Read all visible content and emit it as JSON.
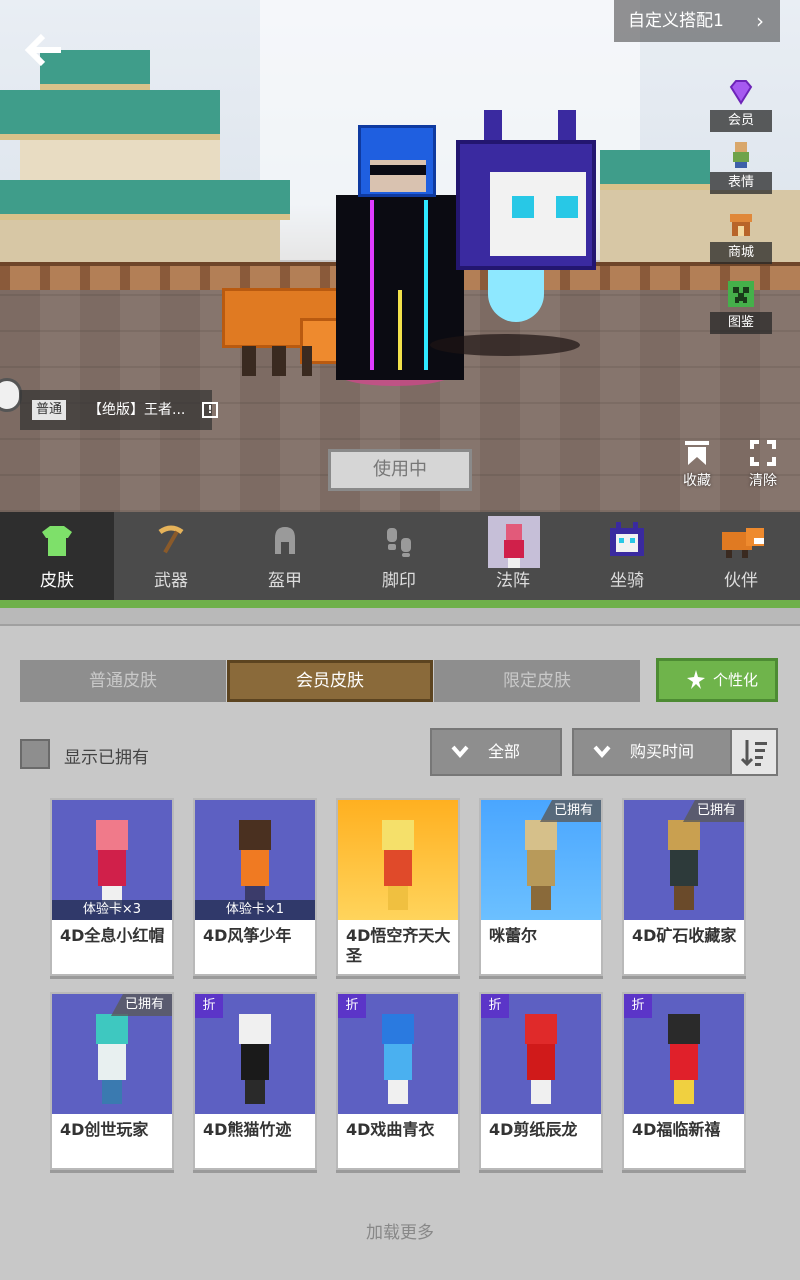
{
  "header": {
    "outfit_label": "自定义搭配1",
    "outfit_chevron": "›"
  },
  "side_menu": [
    {
      "label": "会员",
      "icon": "gem-icon",
      "color": "#9a3ee8"
    },
    {
      "label": "表情",
      "icon": "emote-icon",
      "color": "#7db35a"
    },
    {
      "label": "商城",
      "icon": "shop-icon",
      "color": "#d9843a"
    },
    {
      "label": "图鉴",
      "icon": "creeper-icon",
      "color": "#3fae46"
    }
  ],
  "current_skin": {
    "tier": "普通",
    "name": "【绝版】王者..."
  },
  "actions": {
    "use_label": "使用中",
    "favorite_label": "收藏",
    "clear_label": "清除"
  },
  "categories": [
    {
      "label": "皮肤",
      "active": true
    },
    {
      "label": "武器"
    },
    {
      "label": "盔甲"
    },
    {
      "label": "脚印"
    },
    {
      "label": "法阵"
    },
    {
      "label": "坐骑"
    },
    {
      "label": "伙伴"
    }
  ],
  "skin_tabs": [
    {
      "label": "普通皮肤"
    },
    {
      "label": "会员皮肤",
      "active": true
    },
    {
      "label": "限定皮肤"
    }
  ],
  "customize_label": "个性化",
  "filters": {
    "show_owned_label": "显示已拥有",
    "category_filter": "全部",
    "sort_filter": "购买时间"
  },
  "skins": [
    {
      "name": "4D全息小红帽",
      "badge_trial": "体验卡×3"
    },
    {
      "name": "4D风筝少年",
      "badge_trial": "体验卡×1"
    },
    {
      "name": "4D悟空齐天大圣"
    },
    {
      "name": "咪蕾尔",
      "badge_owned": "已拥有"
    },
    {
      "name": "4D矿石收藏家",
      "badge_owned": "已拥有"
    },
    {
      "name": "4D创世玩家",
      "badge_owned": "已拥有"
    },
    {
      "name": "4D熊猫竹迹",
      "badge_discount": "折"
    },
    {
      "name": "4D戏曲青衣",
      "badge_discount": "折"
    },
    {
      "name": "4D剪纸辰龙",
      "badge_discount": "折"
    },
    {
      "name": "4D福临新禧",
      "badge_discount": "折"
    }
  ],
  "load_more_label": "加载更多",
  "colors": {
    "accent_green": "#6fb44b",
    "active_tab_brown": "#8a6a3a",
    "discount_purple": "#5b35c8"
  }
}
